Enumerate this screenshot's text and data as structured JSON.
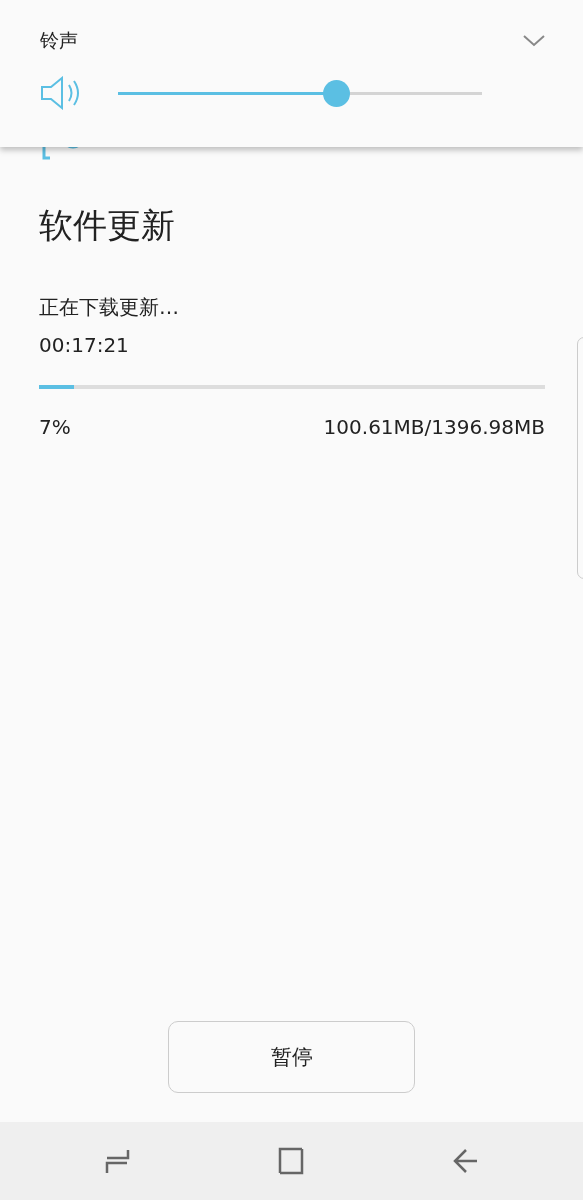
{
  "volume_panel": {
    "label": "铃声",
    "slider": {
      "level": 0.6
    }
  },
  "update": {
    "title": "软件更新",
    "status": "正在下载更新…",
    "elapsed": "00:17:21",
    "progress": {
      "level": 0.07
    },
    "percent": "7%",
    "size": "100.61MB/1396.98MB"
  },
  "pause_button": "暂停"
}
